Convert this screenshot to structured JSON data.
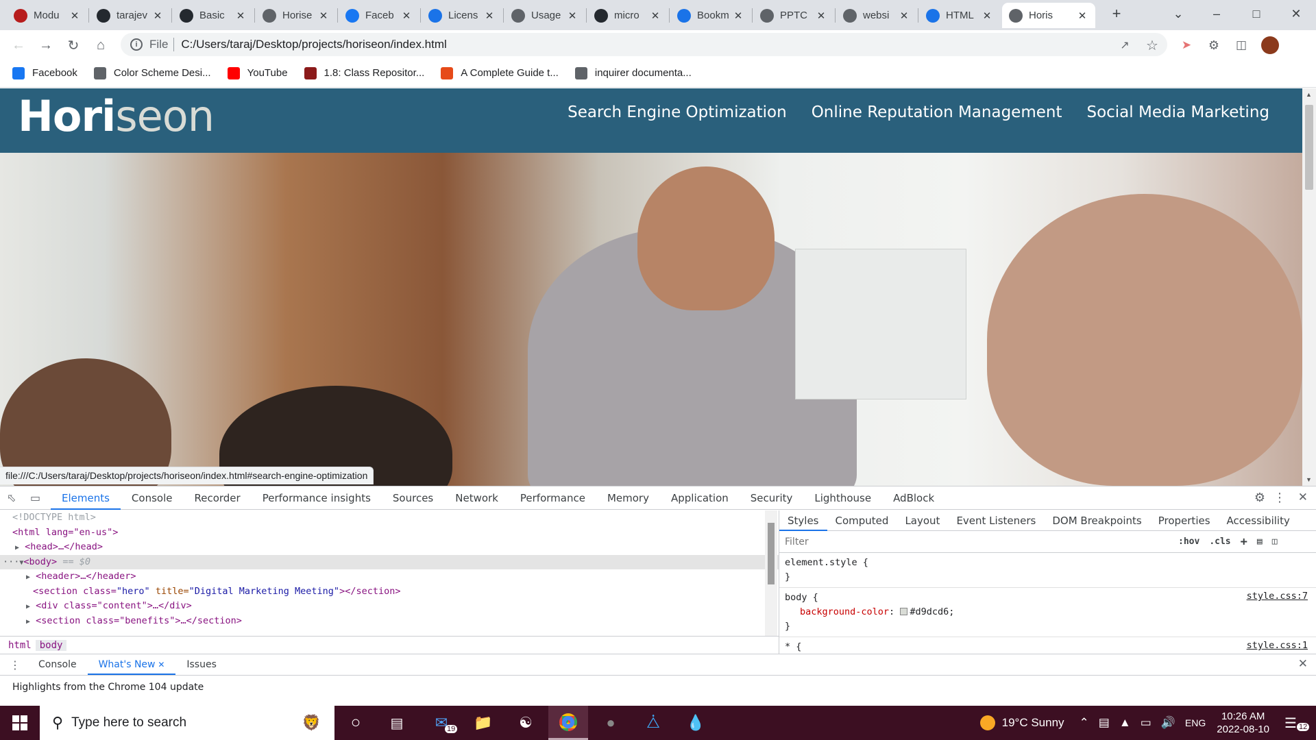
{
  "tabs": [
    {
      "label": "Modu",
      "favicon": "#b71c1c",
      "icon": "module-icon"
    },
    {
      "label": "tarajev",
      "favicon": "#24292f",
      "icon": "github-icon"
    },
    {
      "label": "Basic",
      "favicon": "#24292f",
      "icon": "github-icon"
    },
    {
      "label": "Horise",
      "favicon": "#5f6368",
      "icon": "globe-icon"
    },
    {
      "label": "Faceb",
      "favicon": "#1877f2",
      "icon": "facebook-icon"
    },
    {
      "label": "Licens",
      "favicon": "#1a73e8",
      "icon": "license-icon"
    },
    {
      "label": "Usage",
      "favicon": "#5f6368",
      "icon": "book-icon"
    },
    {
      "label": "micro",
      "favicon": "#24292f",
      "icon": "github-icon"
    },
    {
      "label": "Bookm",
      "favicon": "#1a73e8",
      "icon": "star-icon"
    },
    {
      "label": "PPTC",
      "favicon": "#5f6368",
      "icon": "globe-icon"
    },
    {
      "label": "websi",
      "favicon": "#5f6368",
      "icon": "globe-icon"
    },
    {
      "label": "HTML",
      "favicon": "#1a73e8",
      "icon": "gear-icon"
    },
    {
      "label": "Horis",
      "favicon": "#5f6368",
      "icon": "globe-icon",
      "active": true
    }
  ],
  "address": {
    "scheme_label": "File",
    "url": "C:/Users/taraj/Desktop/projects/horiseon/index.html"
  },
  "bookmarks": [
    {
      "label": "Facebook",
      "icon": "facebook-icon",
      "color": "#1877f2"
    },
    {
      "label": "Color Scheme Desi...",
      "icon": "color-scheme-icon",
      "color": "#5f6368"
    },
    {
      "label": "YouTube",
      "icon": "youtube-icon",
      "color": "#ff0000"
    },
    {
      "label": "1.8: Class Repositor...",
      "icon": "class-icon",
      "color": "#8b1a1a"
    },
    {
      "label": "A Complete Guide t...",
      "icon": "asterisk-icon",
      "color": "#e64a19"
    },
    {
      "label": "inquirer documenta...",
      "icon": "doc-icon",
      "color": "#5f6368"
    }
  ],
  "site": {
    "logo_main": "Hori",
    "logo_tail": "seon",
    "nav": [
      "Search Engine Optimization",
      "Online Reputation Management",
      "Social Media Marketing"
    ],
    "header_color": "#2a607c",
    "page_bg": "#d9dcd6"
  },
  "status_url": "file:///C:/Users/taraj/Desktop/projects/horiseon/index.html#search-engine-optimization",
  "devtools": {
    "tabs": [
      "Elements",
      "Console",
      "Recorder",
      "Performance insights",
      "Sources",
      "Network",
      "Performance",
      "Memory",
      "Application",
      "Security",
      "Lighthouse",
      "AdBlock"
    ],
    "active_tab": "Elements",
    "dom": {
      "doctype": "<!DOCTYPE html>",
      "html_open": "<html lang=\"en-us\">",
      "head": "<head>…</head>",
      "body_sel": "<body>",
      "body_marker": "== $0",
      "header": "<header>…</header>",
      "hero_tag": "<section class=",
      "hero_class": "\"hero\"",
      "hero_title_attr": " title=",
      "hero_title_val": "\"Digital Marketing Meeting\"",
      "hero_close": "></section>",
      "content": "<div class=\"content\">…</div>",
      "benefits": "<section class=\"benefits\">…</section>"
    },
    "breadcrumb": [
      "html",
      "body"
    ],
    "style_tabs": [
      "Styles",
      "Computed",
      "Layout",
      "Event Listeners",
      "DOM Breakpoints",
      "Properties",
      "Accessibility"
    ],
    "filter_placeholder": "Filter",
    "filter_buttons": [
      ":hov",
      ".cls",
      "+"
    ],
    "rules": {
      "element_style": "element.style {",
      "close": "}",
      "body_selector": "body {",
      "body_prop": "background-color",
      "body_val": "#d9dcd6;",
      "body_src": "style.css:7",
      "star_selector": "* {",
      "star_src": "style.css:1"
    },
    "drawer_tabs": [
      "Console",
      "What's New",
      "Issues"
    ],
    "drawer_active": "What's New",
    "drawer_text": "Highlights from the Chrome 104 update"
  },
  "taskbar": {
    "search_placeholder": "Type here to search",
    "weather": "19°C  Sunny",
    "lang": "ENG",
    "time": "10:26 AM",
    "date": "2022-08-10",
    "notifications": "12",
    "mail_badge": "19"
  }
}
